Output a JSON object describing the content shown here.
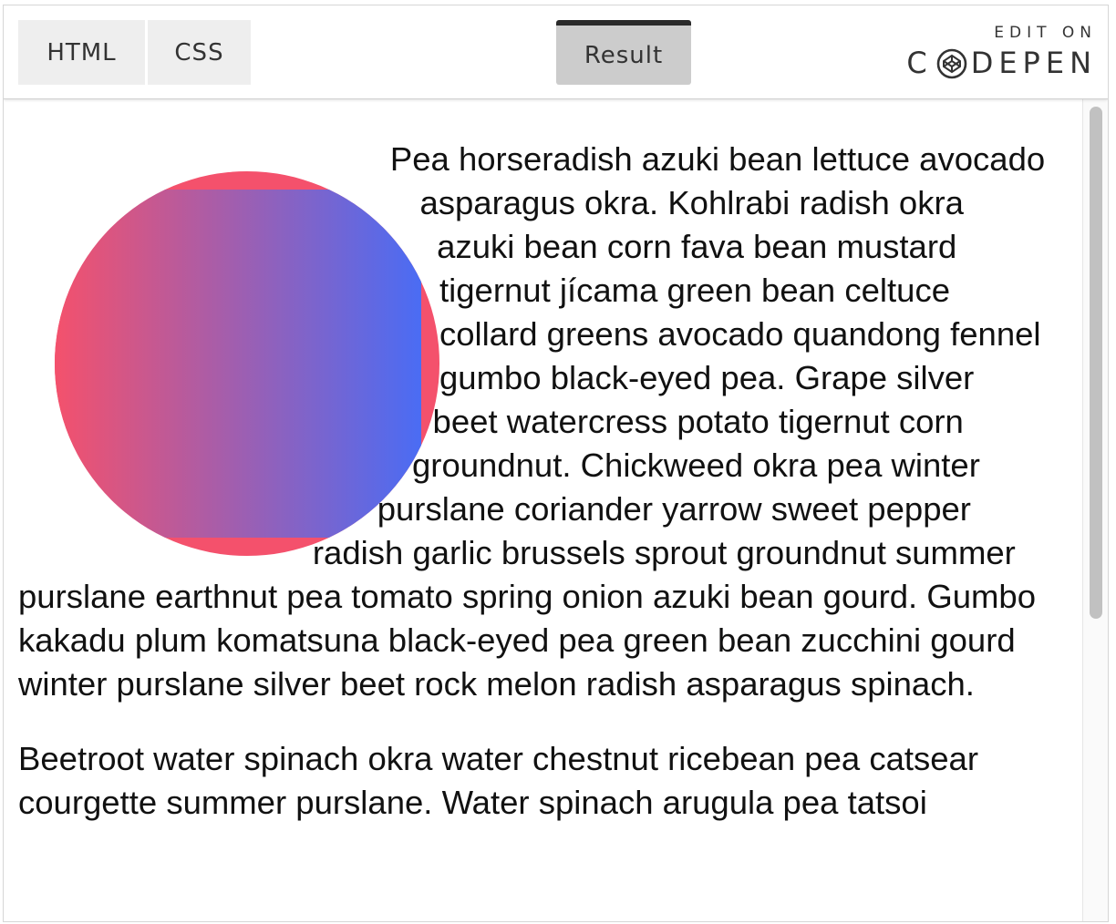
{
  "tabs": {
    "html": "HTML",
    "css": "CSS",
    "result": "Result"
  },
  "codepen": {
    "edit_on": "EDIT ON",
    "brand_left": "C",
    "brand_right": "DEPEN",
    "logo_icon": "codepen-cube-icon"
  },
  "result": {
    "circle": {
      "base_color": "#f4516c",
      "gradient_start": "#f4516c",
      "gradient_end": "#4a6cf4"
    },
    "paragraph1": "Pea horseradish azuki bean lettuce avocado asparagus okra. Kohlrabi radish okra azuki bean corn fava bean mustard tigernut jícama green bean celtuce collard greens avocado quandong fennel gumbo black-eyed pea. Grape silver beet watercress potato tigernut corn groundnut. Chickweed okra pea winter purslane coriander yarrow sweet pepper radish garlic brussels sprout groundnut summer purslane earthnut pea tomato spring onion azuki bean gourd. Gumbo kakadu plum komatsuna black-eyed pea green bean zucchini gourd winter purslane silver beet rock melon radish asparagus spinach.",
    "paragraph2": "Beetroot water spinach okra water chestnut ricebean pea catsear courgette summer purslane. Water spinach arugula pea tatsoi"
  }
}
